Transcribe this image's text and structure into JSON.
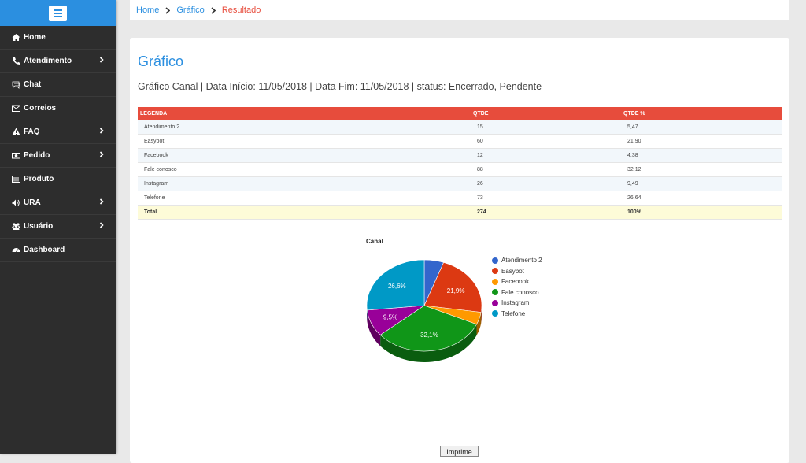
{
  "sidebar": {
    "items": [
      {
        "label": "Home",
        "icon": "home-icon",
        "has_submenu": false
      },
      {
        "label": "Atendimento",
        "icon": "phone-icon",
        "has_submenu": true
      },
      {
        "label": "Chat",
        "icon": "chat-icon",
        "has_submenu": false
      },
      {
        "label": "Correios",
        "icon": "envelope-icon",
        "has_submenu": false
      },
      {
        "label": "FAQ",
        "icon": "warning-icon",
        "has_submenu": true
      },
      {
        "label": "Pedido",
        "icon": "money-icon",
        "has_submenu": true
      },
      {
        "label": "Produto",
        "icon": "list-icon",
        "has_submenu": false
      },
      {
        "label": "URA",
        "icon": "volume-icon",
        "has_submenu": true
      },
      {
        "label": "Usuário",
        "icon": "users-icon",
        "has_submenu": true
      },
      {
        "label": "Dashboard",
        "icon": "dashboard-icon",
        "has_submenu": false
      }
    ]
  },
  "breadcrumb": {
    "home": "Home",
    "grafico": "Gráfico",
    "resultado": "Resultado"
  },
  "page": {
    "title": "Gráfico",
    "subtitle": "Gráfico Canal | Data Início: 11/05/2018 | Data Fim: 11/05/2018 | status: Encerrado, Pendente"
  },
  "table": {
    "headers": [
      "LEGENDA",
      "QTDE",
      "QTDE %"
    ],
    "rows": [
      [
        "Atendimento 2",
        "15",
        "5,47"
      ],
      [
        "Easybot",
        "60",
        "21,90"
      ],
      [
        "Facebook",
        "12",
        "4,38"
      ],
      [
        "Fale conosco",
        "88",
        "32,12"
      ],
      [
        "Instagram",
        "26",
        "9,49"
      ],
      [
        "Telefone",
        "73",
        "26,64"
      ]
    ],
    "total": [
      "Total",
      "274",
      "100%"
    ]
  },
  "chart_data": {
    "type": "pie",
    "title": "Canal",
    "categories": [
      "Atendimento 2",
      "Easybot",
      "Facebook",
      "Fale conosco",
      "Instagram",
      "Telefone"
    ],
    "values": [
      15,
      60,
      12,
      88,
      26,
      73
    ],
    "labels": [
      "",
      "21,9%",
      "",
      "32,1%",
      "9,5%",
      "26,6%"
    ],
    "colors": [
      "#3366cc",
      "#dc3912",
      "#ff9900",
      "#109618",
      "#990099",
      "#0099c6"
    ],
    "legend_position": "right"
  },
  "actions": {
    "print_label": "Imprime"
  }
}
